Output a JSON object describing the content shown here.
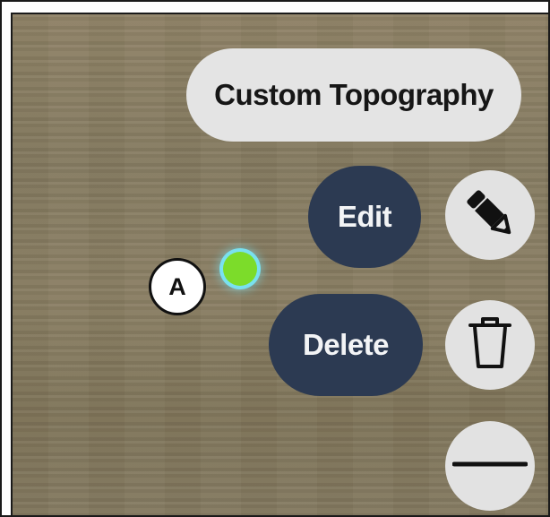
{
  "menu": {
    "title_chip": "Custom Topography",
    "edit_label": "Edit",
    "delete_label": "Delete",
    "icons": {
      "edit": "pencil-icon",
      "delete": "trash-icon",
      "collapse": "minus-icon"
    }
  },
  "marker": {
    "label": "A",
    "point_color": "#7cdc2a",
    "halo_color": "#78ebff"
  },
  "colors": {
    "pill_bg": "#2c3a52",
    "fab_bg": "#e2e2e2",
    "chip_bg": "#e4e4e4"
  }
}
